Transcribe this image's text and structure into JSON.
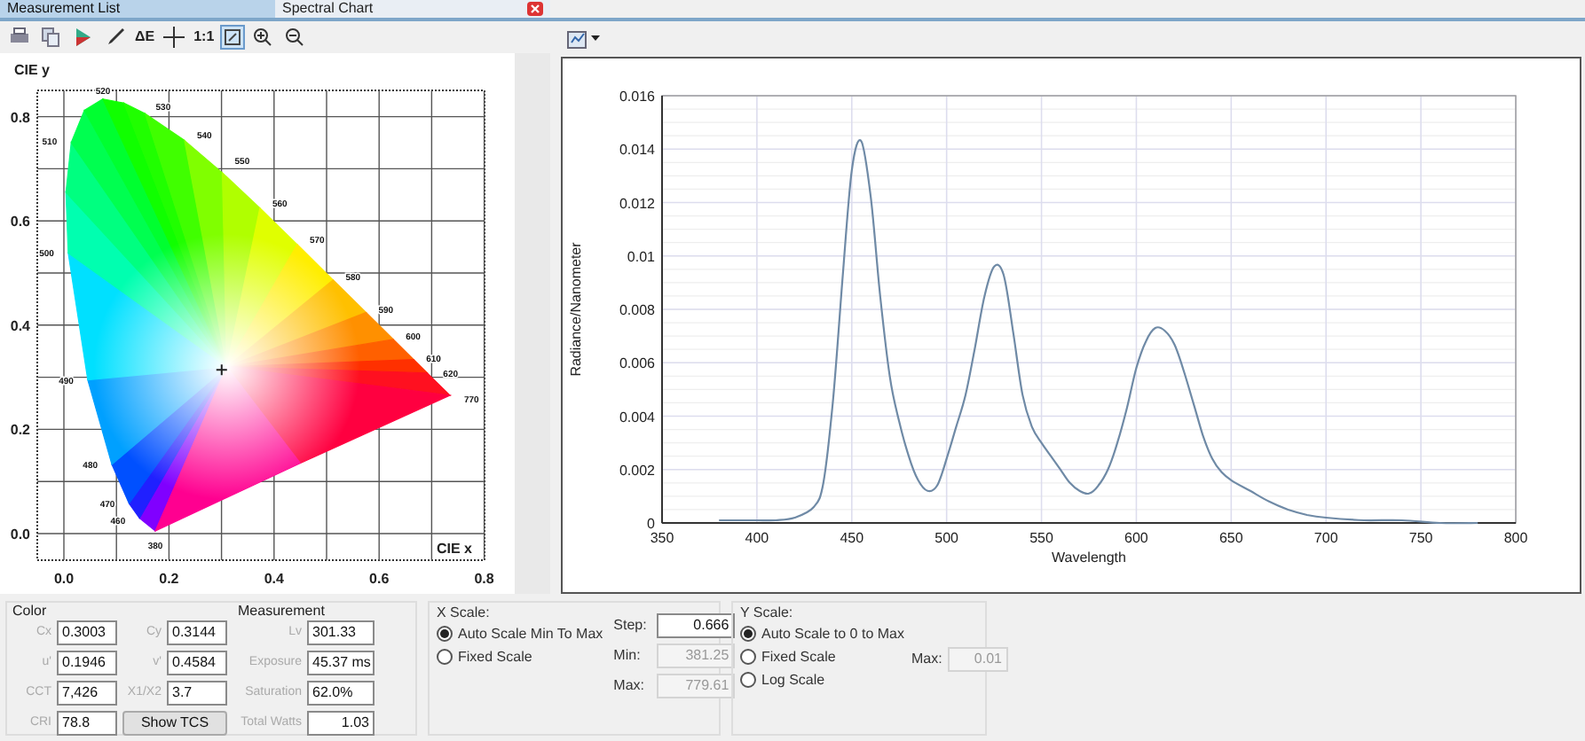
{
  "tabs": [
    {
      "label": "Measurement List",
      "selected": true,
      "closable": false
    },
    {
      "label": "Spectral Chart",
      "selected": false,
      "closable": true
    }
  ],
  "cie_toolbar": [
    {
      "kind": "print"
    },
    {
      "kind": "copy"
    },
    {
      "kind": "color"
    },
    {
      "kind": "pen"
    },
    {
      "kind": "text",
      "label": "ΔE"
    },
    {
      "kind": "crosshair"
    },
    {
      "kind": "text",
      "label": "1:1"
    },
    {
      "kind": "fit",
      "selected": true
    },
    {
      "kind": "zoom-in"
    },
    {
      "kind": "zoom-out"
    }
  ],
  "cie_diagram": {
    "y_label": "CIE y",
    "x_label": "CIE x",
    "x_ticks": [
      "0.0",
      "0.2",
      "0.4",
      "0.6",
      "0.8"
    ],
    "y_ticks": [
      "0.8",
      "0.6",
      "0.4",
      "0.2",
      "0.0"
    ],
    "wavelength_labels": [
      "520",
      "530",
      "540",
      "550",
      "560",
      "570",
      "580",
      "590",
      "600",
      "610",
      "620",
      "770",
      "510",
      "500",
      "490",
      "480",
      "470",
      "460",
      "380"
    ]
  },
  "spectral_chart": {
    "chart_data": {
      "type": "line",
      "grid": true,
      "xlabel": "Wavelength",
      "ylabel": "Radiance/Nanometer",
      "xlim": [
        350,
        800
      ],
      "ylim": [
        0,
        0.016
      ],
      "xticks": [
        350,
        400,
        450,
        500,
        550,
        600,
        650,
        700,
        750,
        800
      ],
      "yticks": [
        0,
        0.002,
        0.004,
        0.006,
        0.008,
        0.01,
        0.012,
        0.014,
        0.016
      ],
      "x": [
        380,
        390,
        400,
        410,
        420,
        430,
        435,
        440,
        445,
        450,
        455,
        460,
        465,
        470,
        475,
        480,
        485,
        490,
        495,
        500,
        505,
        510,
        515,
        520,
        525,
        530,
        535,
        540,
        545,
        550,
        555,
        560,
        565,
        570,
        575,
        580,
        585,
        590,
        595,
        600,
        605,
        610,
        615,
        620,
        625,
        630,
        635,
        640,
        645,
        650,
        660,
        670,
        680,
        690,
        700,
        720,
        740,
        760,
        780
      ],
      "series": [
        {
          "color": "#6f8aa6",
          "values": [
            0.0001,
            0.0001,
            0.0001,
            0.0001,
            0.0002,
            0.0006,
            0.0015,
            0.0045,
            0.009,
            0.0132,
            0.0143,
            0.0122,
            0.0085,
            0.0055,
            0.0038,
            0.0025,
            0.0016,
            0.0012,
            0.0014,
            0.0024,
            0.0036,
            0.0048,
            0.0066,
            0.0085,
            0.0096,
            0.0093,
            0.0072,
            0.0048,
            0.0036,
            0.003,
            0.0025,
            0.002,
            0.0015,
            0.0012,
            0.0011,
            0.0014,
            0.002,
            0.003,
            0.0043,
            0.0058,
            0.0068,
            0.0073,
            0.0072,
            0.0067,
            0.0057,
            0.0045,
            0.0033,
            0.0024,
            0.0019,
            0.0016,
            0.0012,
            0.0008,
            0.0005,
            0.0003,
            0.0002,
            0.0001,
            0.0001,
            0,
            0
          ]
        }
      ]
    }
  },
  "color": {
    "title": "Color",
    "fields": [
      {
        "label": "Cx",
        "value": "0.3003"
      },
      {
        "label": "Cy",
        "value": "0.3144"
      },
      {
        "label": "u'",
        "value": "0.1946"
      },
      {
        "label": "v'",
        "value": "0.4584"
      },
      {
        "label": "CCT",
        "value": "7,426"
      },
      {
        "label": "X1/X2",
        "value": "3.7"
      },
      {
        "label": "CRI",
        "value": "78.8"
      }
    ],
    "button": "Show TCS"
  },
  "measurement": {
    "title": "Measurement",
    "fields": [
      {
        "label": "Lv",
        "value": "301.33"
      },
      {
        "label": "Exposure",
        "value": "45.37 ms"
      },
      {
        "label": "Saturation",
        "value": "62.0%"
      },
      {
        "label": "Total Watts",
        "value": "1.03"
      }
    ]
  },
  "x_scale": {
    "title": "X Scale:",
    "options": [
      {
        "label": "Auto Scale Min To Max",
        "selected": true
      },
      {
        "label": "Fixed Scale",
        "selected": false
      }
    ],
    "fields": [
      {
        "label": "Step:",
        "value": "0.666",
        "disabled": false
      },
      {
        "label": "Min:",
        "value": "381.25",
        "disabled": true
      },
      {
        "label": "Max:",
        "value": "779.61",
        "disabled": true
      }
    ]
  },
  "y_scale": {
    "title": "Y Scale:",
    "options": [
      {
        "label": "Auto Scale to 0 to Max",
        "selected": true
      },
      {
        "label": "Fixed Scale",
        "selected": false
      },
      {
        "label": "Log Scale",
        "selected": false
      }
    ],
    "fields": [
      {
        "label": "Max:",
        "value": "0.01",
        "disabled": true
      }
    ]
  }
}
